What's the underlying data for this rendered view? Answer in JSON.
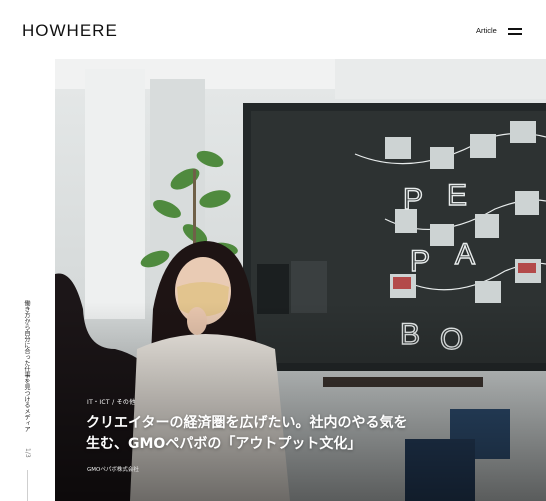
{
  "header": {
    "logo_text": "HOWHERE",
    "nav_article": "Article",
    "menu_icon": "hamburger-menu-icon"
  },
  "side": {
    "tagline": "働き方から自分に合った仕事を見つけるメディア",
    "page_indicator": "1/3"
  },
  "hero": {
    "category": "IT・ICT / その他",
    "title": "クリエイターの経済圏を広げたい。社内のやる気を生む、GMOペパボの「アウトプット文化」",
    "company": "GMOペパボ株式会社",
    "board_letters": [
      "P",
      "E",
      "P",
      "A",
      "B",
      "O"
    ]
  },
  "colors": {
    "board": "#2d3232",
    "wall": "#dfe2e2",
    "text": "#111111"
  }
}
